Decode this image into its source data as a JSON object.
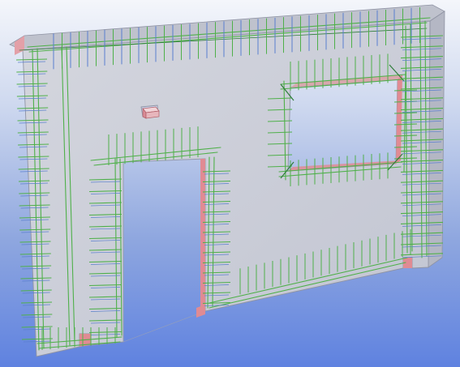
{
  "scene": {
    "view": "3d-isometric",
    "object": "precast-wall-panel-with-rebar",
    "openings": [
      "door-opening",
      "window-opening"
    ],
    "embedded_item": "embedded-plate",
    "colors": {
      "background_top": "#f4f6fb",
      "background_bottom": "#5f82e0",
      "panel_face": "#c9cbd5",
      "panel_edge": "#8f93a3",
      "rebar_green": "#4fb04a",
      "rebar_dark": "#2f7d3b",
      "rebar_blue": "#5a7fcf",
      "cut_face": "#e08b93"
    }
  }
}
